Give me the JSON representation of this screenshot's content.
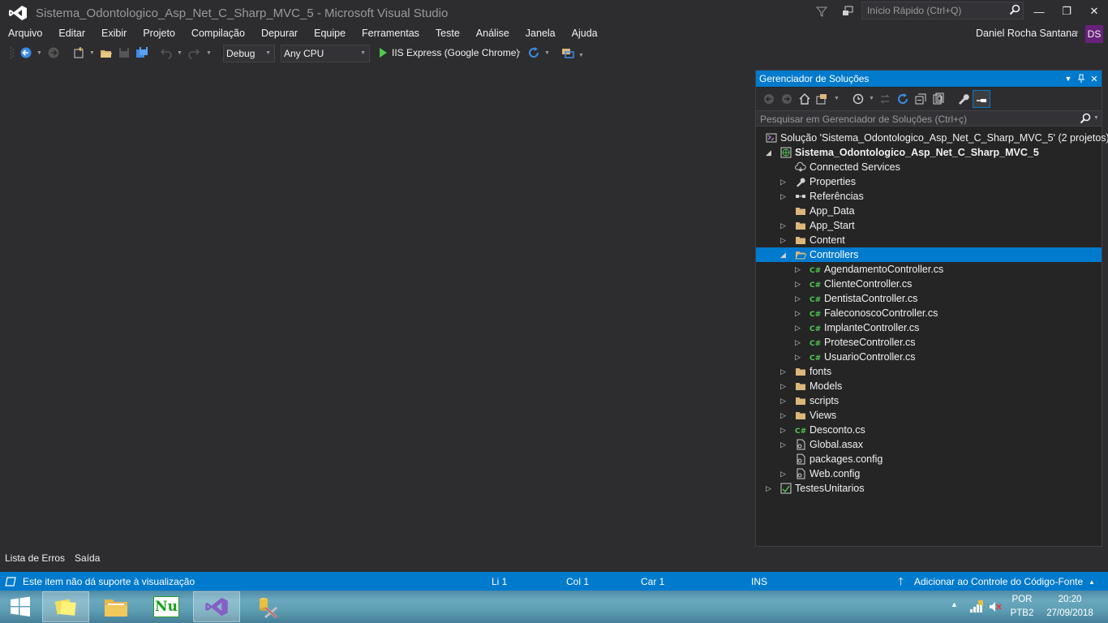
{
  "window": {
    "title": "Sistema_Odontologico_Asp_Net_C_Sharp_MVC_5 - Microsoft Visual Studio",
    "quick_launch_placeholder": "Início Rápido (Ctrl+Q)",
    "minimize": "—",
    "maximize": "❐",
    "close": "✕"
  },
  "menu": {
    "items": [
      "Arquivo",
      "Editar",
      "Exibir",
      "Projeto",
      "Compilação",
      "Depurar",
      "Equipe",
      "Ferramentas",
      "Teste",
      "Análise",
      "Janela",
      "Ajuda"
    ],
    "user_name": "Daniel Rocha Santana",
    "avatar_initials": "DS"
  },
  "toolbar": {
    "configuration": "Debug",
    "platform": "Any CPU",
    "run_target": "IIS Express (Google Chrome)"
  },
  "solution_explorer": {
    "title": "Gerenciador de Soluções",
    "search_placeholder": "Pesquisar em Gerenciador de Soluções (Ctrl+ç)",
    "tree": [
      {
        "label": "Solução 'Sistema_Odontologico_Asp_Net_C_Sharp_MVC_5' (2 projetos)",
        "level": 0,
        "expander": "",
        "icon": "solution-icon"
      },
      {
        "label": "Sistema_Odontologico_Asp_Net_C_Sharp_MVC_5",
        "level": 0,
        "expander": "◢",
        "icon": "web-project-icon",
        "bold": true
      },
      {
        "label": "Connected Services",
        "level": 1,
        "expander": "",
        "icon": "cloud-icon"
      },
      {
        "label": "Properties",
        "level": 1,
        "expander": "▷",
        "icon": "wrench-icon"
      },
      {
        "label": "Referências",
        "level": 1,
        "expander": "▷",
        "icon": "references-icon"
      },
      {
        "label": "App_Data",
        "level": 1,
        "expander": "",
        "icon": "folder-icon"
      },
      {
        "label": "App_Start",
        "level": 1,
        "expander": "▷",
        "icon": "folder-icon"
      },
      {
        "label": "Content",
        "level": 1,
        "expander": "▷",
        "icon": "folder-icon"
      },
      {
        "label": "Controllers",
        "level": 1,
        "expander": "◢",
        "icon": "folder-open-icon",
        "selected": true
      },
      {
        "label": "AgendamentoController.cs",
        "level": 2,
        "expander": "▷",
        "icon": "csharp-file-icon"
      },
      {
        "label": "ClienteController.cs",
        "level": 2,
        "expander": "▷",
        "icon": "csharp-file-icon"
      },
      {
        "label": "DentistaController.cs",
        "level": 2,
        "expander": "▷",
        "icon": "csharp-file-icon"
      },
      {
        "label": "FaleconoscoController.cs",
        "level": 2,
        "expander": "▷",
        "icon": "csharp-file-icon"
      },
      {
        "label": "ImplanteController.cs",
        "level": 2,
        "expander": "▷",
        "icon": "csharp-file-icon"
      },
      {
        "label": "ProteseController.cs",
        "level": 2,
        "expander": "▷",
        "icon": "csharp-file-icon"
      },
      {
        "label": "UsuarioController.cs",
        "level": 2,
        "expander": "▷",
        "icon": "csharp-file-icon"
      },
      {
        "label": "fonts",
        "level": 1,
        "expander": "▷",
        "icon": "folder-icon"
      },
      {
        "label": "Models",
        "level": 1,
        "expander": "▷",
        "icon": "folder-icon"
      },
      {
        "label": "scripts",
        "level": 1,
        "expander": "▷",
        "icon": "folder-icon"
      },
      {
        "label": "Views",
        "level": 1,
        "expander": "▷",
        "icon": "folder-icon"
      },
      {
        "label": "Desconto.cs",
        "level": 1,
        "expander": "▷",
        "icon": "csharp-file-icon"
      },
      {
        "label": "Global.asax",
        "level": 1,
        "expander": "▷",
        "icon": "config-file-icon"
      },
      {
        "label": "packages.config",
        "level": 1,
        "expander": "",
        "icon": "config-file-icon"
      },
      {
        "label": "Web.config",
        "level": 1,
        "expander": "▷",
        "icon": "config-file-icon"
      },
      {
        "label": "TestesUnitarios",
        "level": 0,
        "expander": "▷",
        "icon": "test-project-icon"
      }
    ]
  },
  "bottom_tabs": [
    "Lista de Erros",
    "Saída"
  ],
  "status": {
    "message": "Este item não dá suporte à visualização",
    "line": "Li 1",
    "col": "Col 1",
    "car": "Car 1",
    "ins": "INS",
    "source_control": "Adicionar ao Controle do Código-Fonte"
  },
  "taskbar": {
    "lang": "POR",
    "layout": "PTB2",
    "time": "20:20",
    "date": "27/09/2018",
    "nu_label": "Nu"
  },
  "colors": {
    "accent": "#007acc",
    "background": "#2d2d30",
    "panel": "#252526",
    "vs_purple": "#68217a",
    "csharp_green": "#4ec9b0"
  }
}
